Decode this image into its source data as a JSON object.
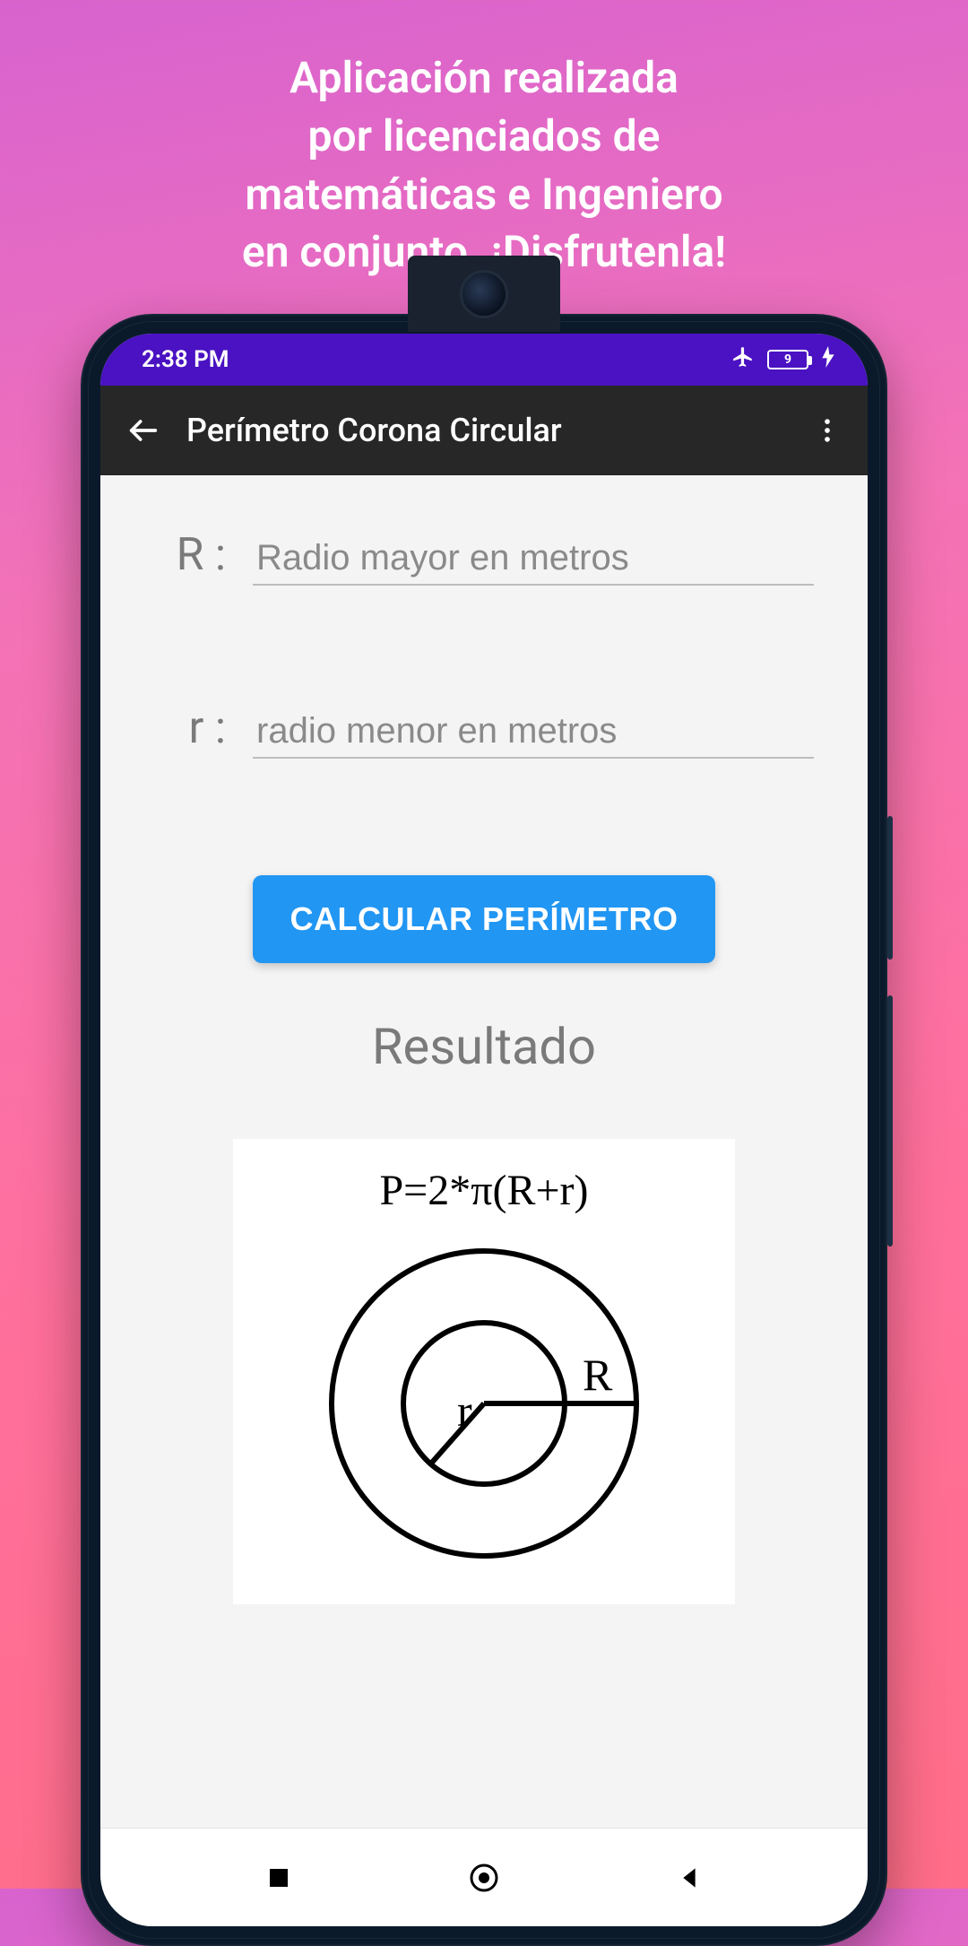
{
  "promo": {
    "line1": "Aplicación realizada",
    "line2": "por licenciados de",
    "line3": "matemáticas e Ingeniero",
    "line4": "en conjunto. ¡Disfrutenla!"
  },
  "status": {
    "time": "2:38 PM",
    "battery_text": "9"
  },
  "appbar": {
    "title": "Perímetro Corona Circular"
  },
  "fields": {
    "R": {
      "label": "R :",
      "placeholder": "Radio mayor en metros",
      "value": ""
    },
    "r": {
      "label": "r :",
      "placeholder": "radio menor en metros",
      "value": ""
    }
  },
  "buttons": {
    "calculate": "CALCULAR PERÍMETRO"
  },
  "result": {
    "label": "Resultado",
    "formula": "P=2*π(R+r)",
    "diagram_label_R": "R",
    "diagram_label_r": "r"
  }
}
